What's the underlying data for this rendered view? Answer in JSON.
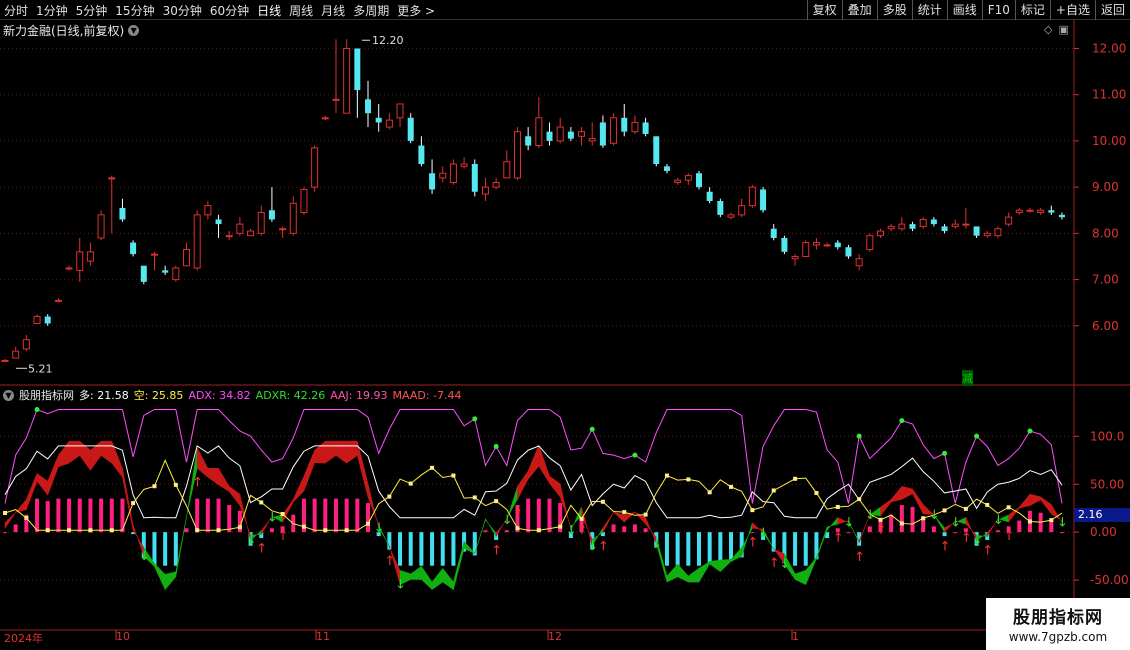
{
  "toolbar": {
    "periods": [
      "分时",
      "1分钟",
      "5分钟",
      "15分钟",
      "30分钟",
      "60分钟",
      "日线",
      "周线",
      "月线",
      "多周期",
      "更多 >"
    ],
    "actions": [
      "复权",
      "叠加",
      "多股",
      "统计",
      "画线",
      "F10",
      "标记",
      "+自选",
      "返回"
    ]
  },
  "stock": {
    "name": "新力金融(日线,前复权)"
  },
  "indicator": {
    "name": "股朋指标网",
    "duo_label": "多:",
    "duo": "21.58",
    "kong_label": "空:",
    "kong": "25.85",
    "adx": "ADX: 34.82",
    "adxr": "ADXR: 42.26",
    "aaj": "AAJ: 19.93",
    "maad": "MAAD: -7.44",
    "current": "2.16"
  },
  "price_axis": [
    "12.00",
    "11.00",
    "10.00",
    "9.00",
    "8.00",
    "7.00",
    "6.00"
  ],
  "ind_axis": [
    "100.0",
    "50.00",
    "0.00",
    "-50.00"
  ],
  "annotations": {
    "high": "12.20",
    "low": "5.21",
    "tag": "减"
  },
  "date_axis": [
    "2024年",
    "10",
    "11",
    "12",
    "1"
  ],
  "watermark": {
    "title": "股朋指标网",
    "url": "www.7gpzb.com"
  },
  "colors": {
    "up": "#e03030",
    "down": "#54e8f0",
    "adx": "#ff4dff",
    "duo": "#ffffff",
    "kong": "#ffee44"
  },
  "chart_data": {
    "type": "candlestick",
    "candles": [
      [
        5.25,
        5.25,
        5.28,
        5.21
      ],
      [
        5.3,
        5.45,
        5.55,
        5.3
      ],
      [
        5.5,
        5.7,
        5.8,
        5.45
      ],
      [
        6.05,
        6.2,
        6.25,
        6.05
      ],
      [
        6.2,
        6.05,
        6.25,
        6.0
      ],
      [
        6.55,
        6.55,
        6.6,
        6.5
      ],
      [
        7.25,
        7.25,
        7.3,
        7.2
      ],
      [
        7.2,
        7.6,
        7.9,
        6.95
      ],
      [
        7.4,
        7.6,
        7.8,
        7.3
      ],
      [
        7.9,
        8.4,
        8.5,
        7.85
      ],
      [
        9.2,
        9.2,
        9.25,
        8.0
      ],
      [
        8.55,
        8.3,
        8.75,
        8.25
      ],
      [
        7.8,
        7.55,
        7.85,
        7.5
      ],
      [
        7.3,
        6.95,
        7.3,
        6.9
      ],
      [
        7.55,
        7.55,
        7.6,
        7.2
      ],
      [
        7.2,
        7.15,
        7.3,
        7.1
      ],
      [
        7.0,
        7.25,
        7.3,
        6.95
      ],
      [
        7.3,
        7.65,
        7.8,
        7.3
      ],
      [
        7.25,
        8.4,
        8.5,
        7.2
      ],
      [
        8.4,
        8.6,
        8.7,
        8.3
      ],
      [
        8.3,
        8.2,
        8.4,
        7.9
      ],
      [
        7.95,
        7.95,
        8.05,
        7.85
      ],
      [
        8.0,
        8.2,
        8.35,
        7.95
      ],
      [
        7.95,
        8.05,
        8.1,
        7.95
      ],
      [
        8.0,
        8.45,
        8.6,
        7.95
      ],
      [
        8.5,
        8.3,
        9.0,
        8.25
      ],
      [
        8.1,
        8.1,
        8.15,
        7.9
      ],
      [
        8.0,
        8.65,
        8.8,
        7.95
      ],
      [
        8.45,
        8.95,
        9.0,
        8.4
      ],
      [
        9.0,
        9.85,
        9.9,
        8.9
      ],
      [
        10.5,
        10.5,
        10.55,
        10.45
      ],
      [
        10.9,
        10.9,
        12.2,
        10.6
      ],
      [
        10.6,
        12.0,
        12.2,
        10.6
      ],
      [
        12.0,
        11.1,
        12.0,
        10.5
      ],
      [
        10.9,
        10.6,
        11.3,
        10.3
      ],
      [
        10.5,
        10.4,
        10.8,
        10.2
      ],
      [
        10.3,
        10.45,
        10.6,
        10.25
      ],
      [
        10.5,
        10.8,
        10.8,
        10.3
      ],
      [
        10.5,
        10.0,
        10.6,
        9.95
      ],
      [
        9.9,
        9.5,
        10.1,
        9.45
      ],
      [
        9.3,
        8.95,
        9.6,
        8.85
      ],
      [
        9.2,
        9.3,
        9.45,
        9.1
      ],
      [
        9.1,
        9.5,
        9.6,
        9.05
      ],
      [
        9.45,
        9.5,
        9.65,
        9.4
      ],
      [
        9.5,
        8.9,
        9.6,
        8.8
      ],
      [
        8.85,
        9.0,
        9.2,
        8.7
      ],
      [
        9.0,
        9.1,
        9.2,
        8.95
      ],
      [
        9.2,
        9.55,
        9.8,
        9.2
      ],
      [
        9.2,
        10.2,
        10.3,
        9.15
      ],
      [
        10.1,
        9.9,
        10.3,
        9.8
      ],
      [
        9.9,
        10.5,
        10.95,
        9.85
      ],
      [
        10.2,
        10.0,
        10.4,
        9.9
      ],
      [
        10.0,
        10.3,
        10.5,
        9.95
      ],
      [
        10.2,
        10.05,
        10.3,
        10.0
      ],
      [
        10.1,
        10.2,
        10.3,
        9.9
      ],
      [
        10.0,
        10.05,
        10.4,
        9.9
      ],
      [
        10.4,
        9.9,
        10.55,
        9.85
      ],
      [
        9.95,
        10.5,
        10.6,
        9.9
      ],
      [
        10.5,
        10.2,
        10.8,
        10.1
      ],
      [
        10.2,
        10.4,
        10.55,
        10.15
      ],
      [
        10.4,
        10.15,
        10.5,
        10.1
      ],
      [
        10.1,
        9.5,
        10.1,
        9.45
      ],
      [
        9.45,
        9.35,
        9.5,
        9.3
      ],
      [
        9.1,
        9.15,
        9.2,
        9.05
      ],
      [
        9.15,
        9.25,
        9.3,
        9.05
      ],
      [
        9.3,
        9.0,
        9.35,
        8.95
      ],
      [
        8.9,
        8.7,
        9.0,
        8.65
      ],
      [
        8.7,
        8.4,
        8.75,
        8.35
      ],
      [
        8.35,
        8.4,
        8.45,
        8.3
      ],
      [
        8.4,
        8.6,
        8.75,
        8.35
      ],
      [
        8.6,
        9.0,
        9.05,
        8.55
      ],
      [
        8.95,
        8.5,
        9.0,
        8.45
      ],
      [
        8.1,
        7.9,
        8.2,
        7.85
      ],
      [
        7.9,
        7.6,
        7.95,
        7.55
      ],
      [
        7.45,
        7.5,
        7.55,
        7.3
      ],
      [
        7.5,
        7.8,
        7.85,
        7.5
      ],
      [
        7.75,
        7.8,
        7.9,
        7.65
      ],
      [
        7.75,
        7.75,
        7.8,
        7.7
      ],
      [
        7.8,
        7.7,
        7.85,
        7.65
      ],
      [
        7.7,
        7.5,
        7.75,
        7.45
      ],
      [
        7.3,
        7.45,
        7.55,
        7.2
      ],
      [
        7.65,
        7.95,
        8.0,
        7.6
      ],
      [
        7.95,
        8.05,
        8.1,
        7.9
      ],
      [
        8.1,
        8.15,
        8.2,
        8.05
      ],
      [
        8.1,
        8.2,
        8.35,
        8.05
      ],
      [
        8.2,
        8.1,
        8.25,
        8.05
      ],
      [
        8.15,
        8.3,
        8.35,
        8.1
      ],
      [
        8.3,
        8.2,
        8.35,
        8.15
      ],
      [
        8.15,
        8.05,
        8.2,
        8.0
      ],
      [
        8.15,
        8.2,
        8.3,
        8.1
      ],
      [
        8.2,
        8.2,
        8.55,
        8.1
      ],
      [
        8.15,
        7.95,
        8.15,
        7.9
      ],
      [
        7.95,
        8.0,
        8.05,
        7.9
      ],
      [
        7.95,
        8.1,
        8.15,
        7.9
      ],
      [
        8.2,
        8.35,
        8.45,
        8.15
      ],
      [
        8.45,
        8.5,
        8.55,
        8.4
      ],
      [
        8.5,
        8.5,
        8.55,
        8.45
      ],
      [
        8.45,
        8.5,
        8.55,
        8.4
      ],
      [
        8.5,
        8.45,
        8.6,
        8.4
      ],
      [
        8.4,
        8.35,
        8.45,
        8.3
      ]
    ],
    "price_range": [
      5.0,
      12.4
    ],
    "ind_range": [
      -100,
      140
    ]
  }
}
